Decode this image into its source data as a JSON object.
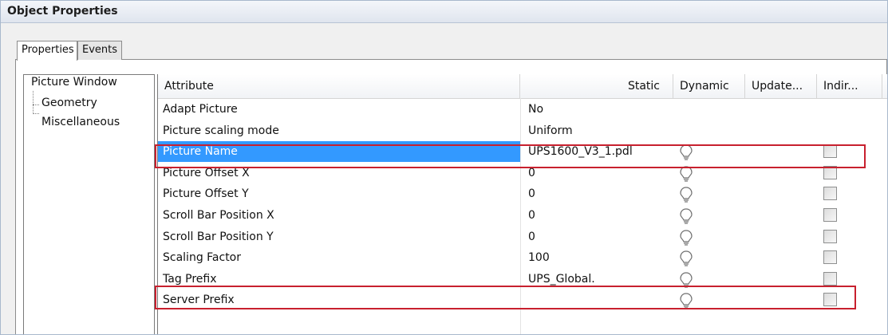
{
  "window": {
    "title": "Object Properties"
  },
  "tabs": [
    {
      "label": "Properties",
      "active": true
    },
    {
      "label": "Events",
      "active": false
    }
  ],
  "tree": {
    "root": "Picture Window",
    "children": [
      "Geometry",
      "Miscellaneous"
    ]
  },
  "grid": {
    "columns": [
      "Attribute",
      "Static",
      "Dynamic",
      "Update...",
      "Indir..."
    ],
    "rows": [
      {
        "attribute": "Adapt Picture",
        "static": "No",
        "dynamic_icon": "",
        "indirect": false
      },
      {
        "attribute": "Picture scaling mode",
        "static": "Uniform",
        "dynamic_icon": "",
        "indirect": false
      },
      {
        "attribute": "Picture Name",
        "static": "UPS1600_V3_1.pdl",
        "dynamic_icon": "lightbulb-icon",
        "indirect": true,
        "selected": true
      },
      {
        "attribute": "Picture Offset X",
        "static": "0",
        "dynamic_icon": "lightbulb-icon",
        "indirect": true
      },
      {
        "attribute": "Picture Offset Y",
        "static": "0",
        "dynamic_icon": "lightbulb-icon",
        "indirect": true
      },
      {
        "attribute": "Scroll Bar Position X",
        "static": "0",
        "dynamic_icon": "lightbulb-icon",
        "indirect": true
      },
      {
        "attribute": "Scroll Bar Position Y",
        "static": "0",
        "dynamic_icon": "lightbulb-icon",
        "indirect": true
      },
      {
        "attribute": "Scaling Factor",
        "static": "100",
        "dynamic_icon": "lightbulb-icon",
        "indirect": true
      },
      {
        "attribute": "Tag Prefix",
        "static": "UPS_Global.",
        "dynamic_icon": "lightbulb-icon",
        "indirect": true
      },
      {
        "attribute": "Server Prefix",
        "static": "",
        "dynamic_icon": "lightbulb-icon",
        "indirect": true
      }
    ]
  },
  "colors": {
    "selection": "#3399ff",
    "highlight": "#c8202e"
  }
}
